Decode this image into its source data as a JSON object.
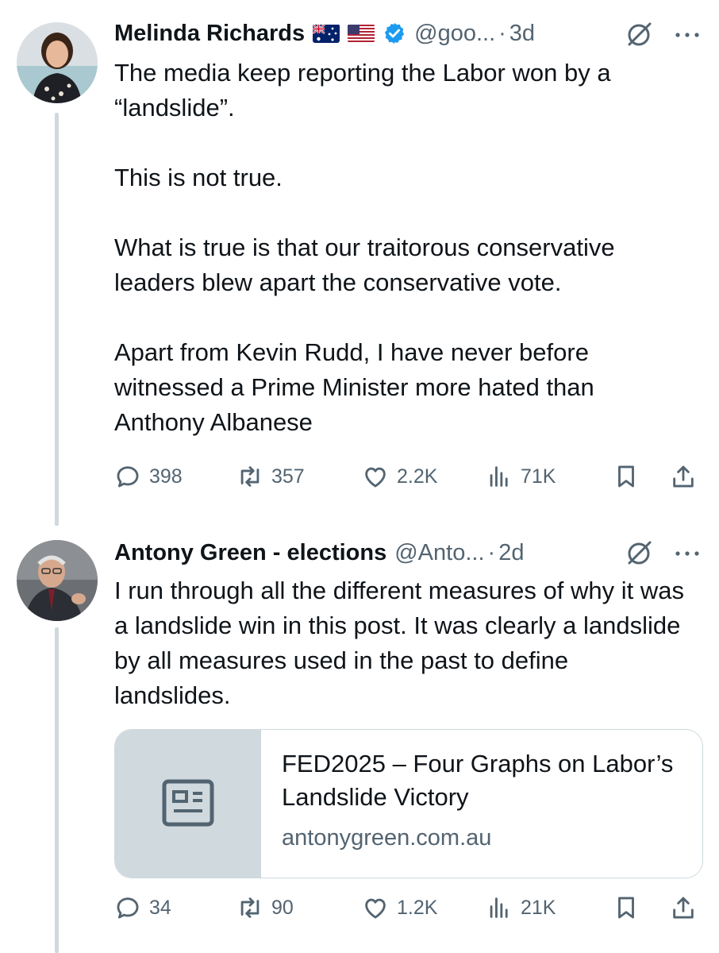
{
  "tweets": [
    {
      "author": "Melinda Richards",
      "handle": "@goo...",
      "time": "3d",
      "body": [
        "The media keep reporting the Labor won by a “landslide”.",
        "This is not true.",
        "What is true is that our traitorous conservative leaders blew apart the conservative vote.",
        "Apart from Kevin Rudd, I have never before witnessed  a Prime Minister more hated than Anthony Albanese"
      ],
      "stats": {
        "replies": "398",
        "reposts": "357",
        "likes": "2.2K",
        "views": "71K"
      }
    },
    {
      "author": "Antony Green - elections",
      "handle": "@Anto...",
      "time": "2d",
      "body": [
        "I run through all the different measures of why it was a landslide win in this post. It was clearly a landslide by all measures used in the past to define landslides."
      ],
      "card": {
        "title": "FED2025 – Four Graphs on Labor’s Landslide Victory",
        "domain": "antonygreen.com.au"
      },
      "stats": {
        "replies": "34",
        "reposts": "90",
        "likes": "1.2K",
        "views": "21K"
      }
    }
  ],
  "separator": "·",
  "icons": {
    "reply": "reply-icon",
    "repost": "repost-icon",
    "like": "heart-icon",
    "views": "views-icon",
    "bookmark": "bookmark-icon",
    "share": "share-icon",
    "verified": "verified-badge-icon",
    "grok": "grok-icon",
    "more": "more-icon",
    "article": "article-icon"
  },
  "colors": {
    "text": "#0f1419",
    "muted": "#536471",
    "verified": "#1d9bf0",
    "border": "#cfd9de"
  }
}
